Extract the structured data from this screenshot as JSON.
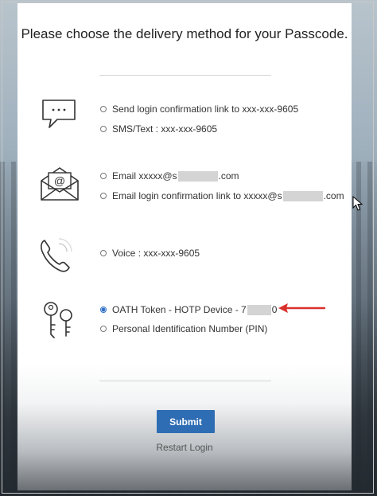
{
  "title": "Please choose the delivery method for your Passcode.",
  "options": [
    {
      "prefix": "Send login confirmation link to xxx-xxx-9605",
      "suffix": "",
      "checked": false
    },
    {
      "prefix": "SMS/Text : xxx-xxx-9605",
      "suffix": "",
      "checked": false
    },
    {
      "prefix": "Email xxxxx@s",
      "suffix": ".com",
      "checked": false
    },
    {
      "prefix": "Email login confirmation link to xxxxx@s",
      "suffix": ".com",
      "checked": false
    },
    {
      "prefix": "Voice : xxx-xxx-9605",
      "suffix": "",
      "checked": false
    },
    {
      "prefix": "OATH Token - HOTP Device - 7",
      "suffix": "0",
      "checked": true
    },
    {
      "prefix": "Personal Identification Number (PIN)",
      "suffix": "",
      "checked": false
    }
  ],
  "icons": {
    "sms": "chat-bubble-icon",
    "email": "envelope-at-icon",
    "voice": "phone-icon",
    "token": "keys-icon"
  },
  "buttons": {
    "submit": "Submit",
    "restart": "Restart Login"
  },
  "colors": {
    "accent": "#2e6db4",
    "annotation": "#d9302c"
  }
}
